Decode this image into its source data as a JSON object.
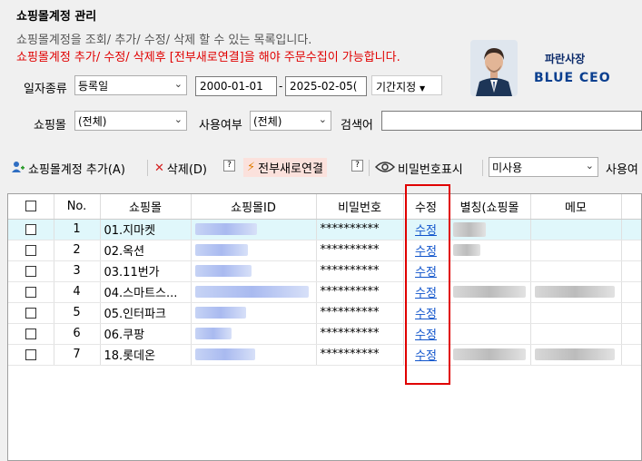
{
  "header": {
    "title": "쇼핑몰계정 관리",
    "description": "쇼핑몰계정을 조회/ 추가/ 수정/ 삭제 할 수 있는 목록입니다.",
    "warning": "쇼핑몰계정 추가/ 수정/ 삭제후 [전부새로연결]을 해야 주문수집이 가능합니다."
  },
  "logo": {
    "korean": "파란사장",
    "english": "BLUE CEO"
  },
  "filters": {
    "date_type_label": "일자종류",
    "date_type_value": "등록일",
    "date_from": "2000-01-01",
    "date_to": "2025-02-05(",
    "range_separator": "-",
    "period_button": "기간지정",
    "mall_label": "쇼핑몰",
    "mall_value": "(전체)",
    "use_label": "사용여부",
    "use_value": "(전체)",
    "search_label": "검색어",
    "search_value": ""
  },
  "toolbar": {
    "add": "쇼핑몰계정 추가(A)",
    "delete": "삭제(D)",
    "reconnect": "전부새로연결",
    "show_password": "비밀번호표시",
    "unused_select": "미사용",
    "use_cut": "사용여",
    "help": "?"
  },
  "table": {
    "headers": [
      "",
      "No.",
      "쇼핑몰",
      "쇼핑몰ID",
      "비밀번호",
      "수정",
      "별칭(쇼핑몰",
      "메모"
    ],
    "rows": [
      {
        "no": "1",
        "mall": "01.지마켓",
        "password": "**********",
        "edit": "수정"
      },
      {
        "no": "2",
        "mall": "02.옥션",
        "password": "**********",
        "edit": "수정"
      },
      {
        "no": "3",
        "mall": "03.11번가",
        "password": "**********",
        "edit": "수정"
      },
      {
        "no": "4",
        "mall": "04.스마트스...",
        "password": "**********",
        "edit": "수정"
      },
      {
        "no": "5",
        "mall": "05.인터파크",
        "password": "**********",
        "edit": "수정"
      },
      {
        "no": "6",
        "mall": "06.쿠팡",
        "password": "**********",
        "edit": "수정"
      },
      {
        "no": "7",
        "mall": "18.롯데온",
        "password": "**********",
        "edit": "수정"
      }
    ]
  }
}
